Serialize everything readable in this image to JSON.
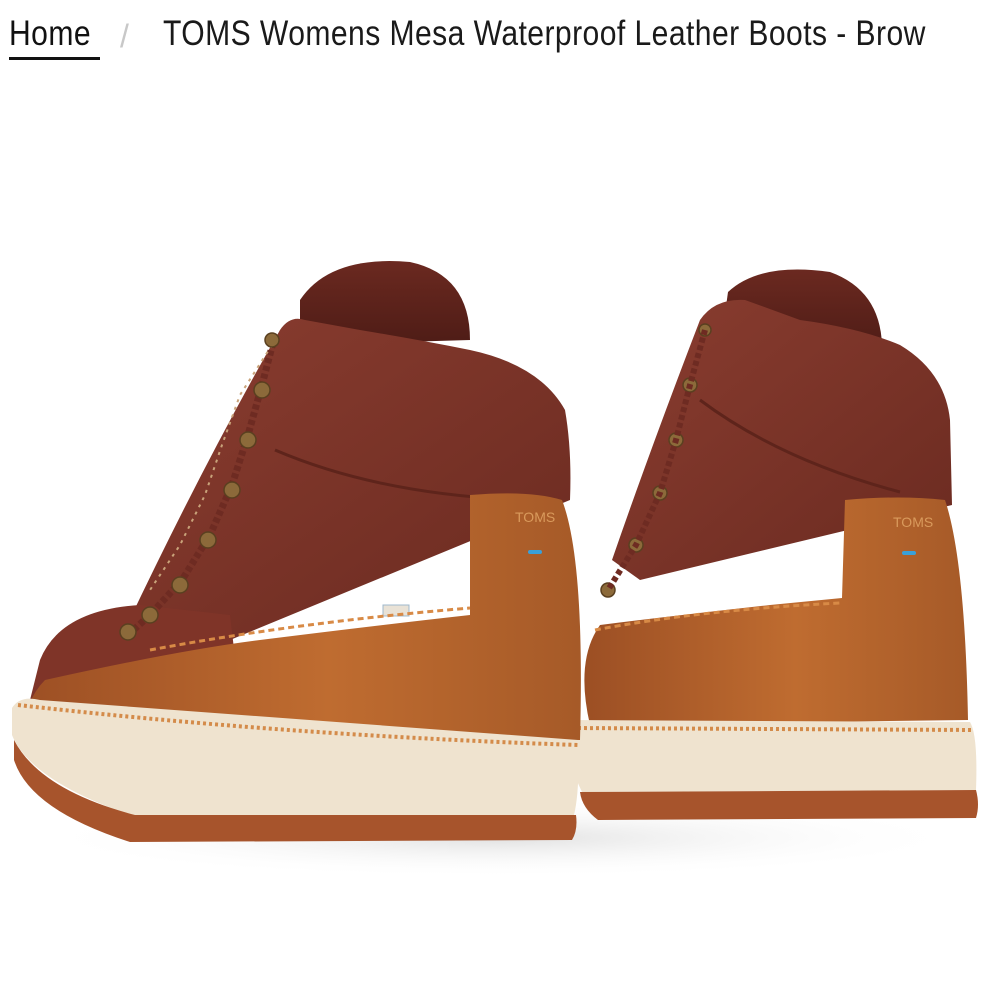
{
  "breadcrumb": {
    "home_label": "Home",
    "separator": "/",
    "current_label": "TOMS Womens Mesa Waterproof Leather Boots - Brow"
  },
  "product_image": {
    "alt": "TOMS Womens Mesa Waterproof Leather Boots",
    "heel_tab_text": "TOMS",
    "colors": {
      "suede": "#7a3328",
      "leather": "#b5652c",
      "midsole": "#efe3cf",
      "outsole": "#a7542c"
    }
  }
}
